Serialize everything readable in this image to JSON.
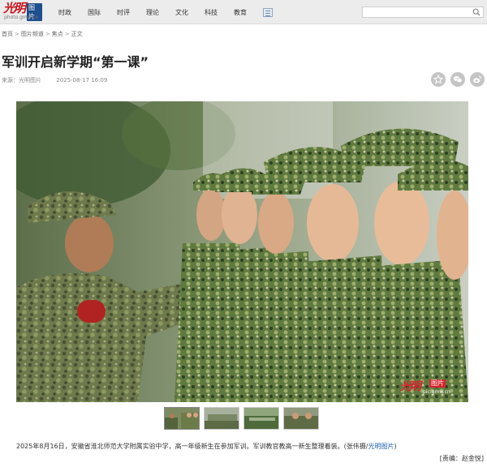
{
  "header": {
    "logo": {
      "main": "光明",
      "badge": "图片",
      "url": "photo.gmw.cn"
    },
    "nav": [
      "时政",
      "国际",
      "时评",
      "理论",
      "文化",
      "科技",
      "教育"
    ],
    "search": {
      "placeholder": ""
    }
  },
  "breadcrumb": [
    "首页",
    "图片频道",
    "焦点",
    "正文"
  ],
  "article": {
    "title": "军训开启新学期“第一课”",
    "source": "来源：光明图片",
    "date": "2025-08-17 16:09",
    "caption_text": "2025年8月16日，安徽省淮北师范大学附属实验中学，高一年级新生在参加军训。军训教官教高一新生整理着装。(张伟摄/",
    "caption_link": "光明图片",
    "caption_end": ")",
    "editor": "[责编：赵金悦]"
  },
  "photo_watermark": {
    "main": "光明",
    "badge": "图片",
    "url": "pic.gmw.cn"
  },
  "thumbnails": [
    {
      "active": true
    },
    {
      "active": false
    },
    {
      "active": false
    },
    {
      "active": false
    }
  ],
  "share_icons": [
    "favorite-icon",
    "wechat-icon",
    "weibo-icon"
  ],
  "colors": {
    "brand_red": "#c8161d",
    "link_blue": "#1a5fb4",
    "topbar_bg": "#ececec"
  }
}
